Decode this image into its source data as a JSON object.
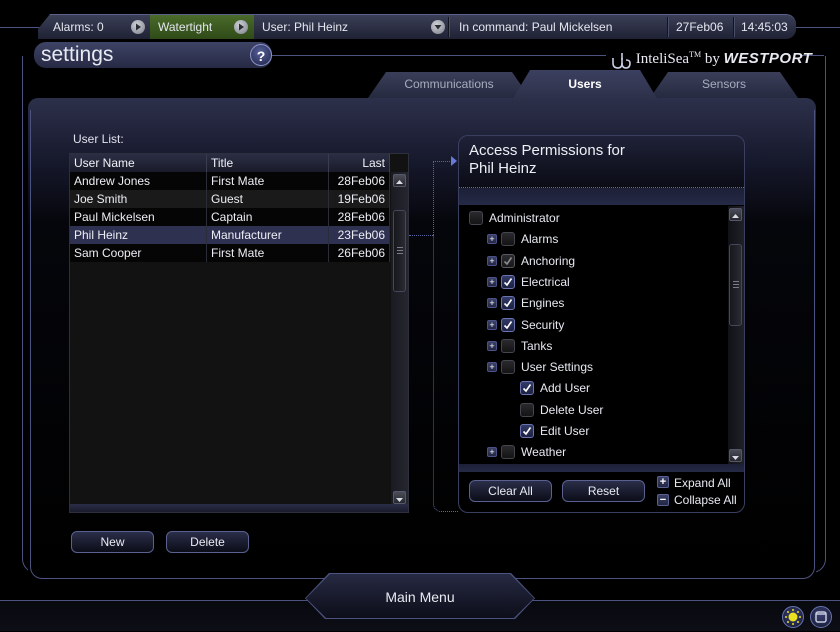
{
  "status_bar": {
    "alarms": "Alarms: 0",
    "mode": "Watertight",
    "user": "User:  Phil Heinz",
    "in_command": "In command:  Paul Mickelsen",
    "date": "27Feb06",
    "time": "14:45:03",
    "mode_color": "#3f5e22"
  },
  "header": {
    "title": "settings",
    "help_label": "?",
    "brand_name": "InteliSea",
    "brand_tm": "TM",
    "brand_by": "by",
    "brand_company": "WESTPORT"
  },
  "tabs": [
    {
      "label": "Communications",
      "active": false
    },
    {
      "label": "Users",
      "active": true
    },
    {
      "label": "Sensors",
      "active": false
    }
  ],
  "user_list": {
    "label": "User List:",
    "columns": [
      "User Name",
      "Title",
      "Last Login"
    ],
    "rows": [
      {
        "name": "Andrew Jones",
        "title": "First Mate",
        "last_login": "28Feb06"
      },
      {
        "name": "Joe Smith",
        "title": "Guest",
        "last_login": "19Feb06"
      },
      {
        "name": "Paul Mickelsen",
        "title": "Captain",
        "last_login": "28Feb06"
      },
      {
        "name": "Phil Heinz",
        "title": "Manufacturer",
        "last_login": "23Feb06",
        "selected": true
      },
      {
        "name": "Sam Cooper",
        "title": "First Mate",
        "last_login": "26Feb06"
      }
    ],
    "new_label": "New",
    "delete_label": "Delete"
  },
  "permissions": {
    "title_line1": "Access Permissions for",
    "title_line2": "Phil Heinz",
    "items": [
      {
        "label": "Administrator",
        "state": "unchecked",
        "level": 0,
        "expandable": false
      },
      {
        "label": "Alarms",
        "state": "unchecked",
        "level": 1,
        "expandable": true
      },
      {
        "label": "Anchoring",
        "state": "partial",
        "level": 1,
        "expandable": true
      },
      {
        "label": "Electrical",
        "state": "checked",
        "level": 1,
        "expandable": true
      },
      {
        "label": "Engines",
        "state": "checked",
        "level": 1,
        "expandable": true
      },
      {
        "label": "Security",
        "state": "checked",
        "level": 1,
        "expandable": true
      },
      {
        "label": "Tanks",
        "state": "unchecked",
        "level": 1,
        "expandable": true
      },
      {
        "label": "User Settings",
        "state": "unchecked",
        "level": 1,
        "expandable": true
      },
      {
        "label": "Add User",
        "state": "checked",
        "level": 2,
        "expandable": false
      },
      {
        "label": "Delete User",
        "state": "unchecked",
        "level": 2,
        "expandable": false
      },
      {
        "label": "Edit User",
        "state": "checked",
        "level": 2,
        "expandable": false
      },
      {
        "label": "Weather",
        "state": "unchecked",
        "level": 1,
        "expandable": true
      }
    ],
    "clear_all_label": "Clear All",
    "reset_label": "Reset",
    "expand_all_label": "Expand All",
    "collapse_all_label": "Collapse All"
  },
  "footer": {
    "main_menu_label": "Main Menu"
  }
}
